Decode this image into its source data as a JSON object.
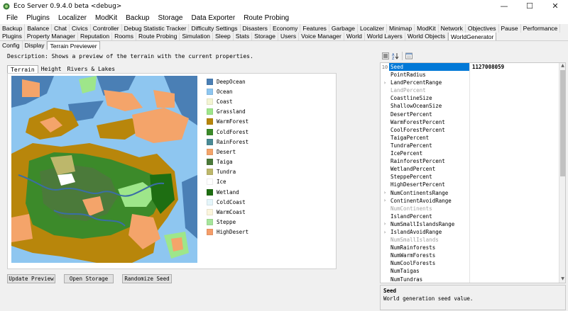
{
  "window": {
    "title": "Eco Server 0.9.4.0 beta <debug>",
    "minimize_glyph": "—",
    "maximize_glyph": "☐",
    "close_glyph": "✕"
  },
  "menu": [
    "File",
    "Plugins",
    "Localizer",
    "ModKit",
    "Backup",
    "Storage",
    "Data Exporter",
    "Route Probing"
  ],
  "tabs_row1": [
    "Backup",
    "Balance",
    "Chat",
    "Civics",
    "Controller",
    "Debug Statistic Tracker",
    "Difficulty Settings",
    "Disasters",
    "Economy",
    "Features",
    "Garbage",
    "Localizer",
    "Minimap",
    "ModKit",
    "Network",
    "Objectives",
    "Pause",
    "Performance"
  ],
  "tabs_row2": [
    "Plugins",
    "Property Manager",
    "Reputation",
    "Rooms",
    "Route Probing",
    "Simulation",
    "Sleep",
    "Stats",
    "Storage",
    "Users",
    "Voice Manager",
    "World",
    "World Layers",
    "World Objects",
    "WorldGenerator"
  ],
  "tabs_row2_active": "WorldGenerator",
  "subtabs": [
    "Config",
    "Display",
    "Terrain Previewer"
  ],
  "subtabs_active": "Terrain Previewer",
  "description": "Description: Shows a preview of the terrain with the current properties.",
  "preview_tabs": [
    "Terrain",
    "Height",
    "Rivers & Lakes"
  ],
  "preview_tabs_active": "Terrain",
  "legend": [
    {
      "label": "DeepOcean",
      "color": "#4a7fb5"
    },
    {
      "label": "Ocean",
      "color": "#8ec6f0"
    },
    {
      "label": "Coast",
      "color": "#f3f4d2"
    },
    {
      "label": "Grassland",
      "color": "#9ee68a"
    },
    {
      "label": "WarmForest",
      "color": "#b8860b"
    },
    {
      "label": "ColdForest",
      "color": "#3c8a2a"
    },
    {
      "label": "RainForest",
      "color": "#4a8a95"
    },
    {
      "label": "Desert",
      "color": "#f4a46a"
    },
    {
      "label": "Taiga",
      "color": "#4b7a3a"
    },
    {
      "label": "Tundra",
      "color": "#bdb76b"
    },
    {
      "label": "Ice",
      "color": "#ffffff"
    },
    {
      "label": "Wetland",
      "color": "#1e6e12"
    },
    {
      "label": "ColdCoast",
      "color": "#e4f5fa"
    },
    {
      "label": "WarmCoast",
      "color": "#fbf5dc"
    },
    {
      "label": "Steppe",
      "color": "#a6e59b"
    },
    {
      "label": "HighDesert",
      "color": "#f59d6a"
    }
  ],
  "buttons": {
    "update_preview": "Update Preview",
    "open_storage": "Open Storage",
    "randomize_seed": "Randomize Seed"
  },
  "toolbar_icons": [
    "categorized-sort-icon",
    "alphabetical-sort-icon",
    "property-pages-icon"
  ],
  "properties": [
    {
      "name": "Seed",
      "value": "1127008059",
      "selected": true,
      "gutter": "10"
    },
    {
      "name": "PointRadius",
      "value": ""
    },
    {
      "name": "LandPercentRange",
      "value": "",
      "expandable": true
    },
    {
      "name": "LandPercent",
      "value": "",
      "disabled": true
    },
    {
      "name": "CoastlineSize",
      "value": ""
    },
    {
      "name": "ShallowOceanSize",
      "value": ""
    },
    {
      "name": "DesertPercent",
      "value": ""
    },
    {
      "name": "WarmForestPercent",
      "value": ""
    },
    {
      "name": "CoolForestPercent",
      "value": ""
    },
    {
      "name": "TaigaPercent",
      "value": ""
    },
    {
      "name": "TundraPercent",
      "value": ""
    },
    {
      "name": "IcePercent",
      "value": ""
    },
    {
      "name": "RainforestPercent",
      "value": ""
    },
    {
      "name": "WetlandPercent",
      "value": ""
    },
    {
      "name": "SteppePercent",
      "value": ""
    },
    {
      "name": "HighDesertPercent",
      "value": ""
    },
    {
      "name": "NumContinentsRange",
      "value": "",
      "expandable": true
    },
    {
      "name": "ContinentAvoidRange",
      "value": "",
      "expandable": true
    },
    {
      "name": "NumContinents",
      "value": "",
      "disabled": true
    },
    {
      "name": "IslandPercent",
      "value": ""
    },
    {
      "name": "NumSmallIslandsRange",
      "value": "",
      "expandable": true
    },
    {
      "name": "IslandAvoidRange",
      "value": "",
      "expandable": true
    },
    {
      "name": "NumSmallIslands",
      "value": "",
      "disabled": true
    },
    {
      "name": "NumRainforests",
      "value": ""
    },
    {
      "name": "NumWarmForests",
      "value": ""
    },
    {
      "name": "NumCoolForests",
      "value": ""
    },
    {
      "name": "NumTaigas",
      "value": ""
    },
    {
      "name": "NumTundras",
      "value": ""
    }
  ],
  "help": {
    "title": "Seed",
    "text": "World generation seed value."
  }
}
